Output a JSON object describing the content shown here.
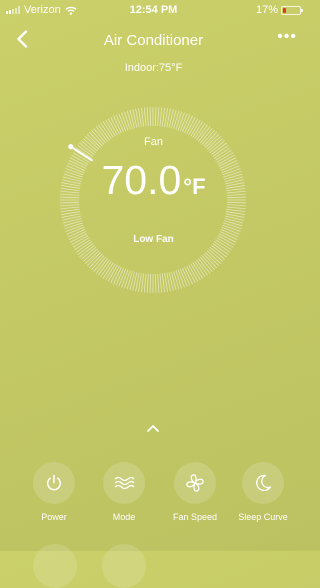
{
  "status_bar": {
    "carrier": "Verizon",
    "time": "12:54 PM",
    "battery": "17%",
    "battery_level": 0.17
  },
  "nav": {
    "title": "Air Conditioner",
    "indoor": "Indoor:75°F"
  },
  "thermostat": {
    "mode": "Fan",
    "temperature": "70.0",
    "unit": "°F",
    "fan_speed": "Low Fan"
  },
  "controls": [
    {
      "label": "Power",
      "icon": "power-icon"
    },
    {
      "label": "Mode",
      "icon": "mode-icon"
    },
    {
      "label": "Fan Speed",
      "icon": "fan-icon"
    },
    {
      "label": "Sleep Curve",
      "icon": "moon-icon"
    }
  ],
  "colors": {
    "background": "#c6cb66",
    "battery_low": "#e0352d"
  }
}
